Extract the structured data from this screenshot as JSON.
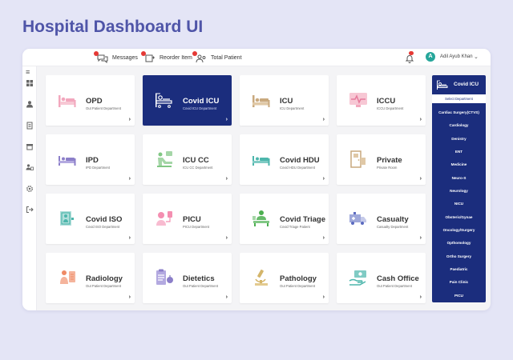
{
  "page": {
    "title": "Hospital Dashboard UI"
  },
  "topbar": {
    "items": [
      {
        "label": "Messages",
        "badge": "",
        "icon": "messages-icon"
      },
      {
        "label": "Reorder Item",
        "badge": "",
        "icon": "reorder-icon"
      },
      {
        "label": "Total Patient",
        "badge": "",
        "icon": "patients-icon"
      }
    ],
    "notification_icon": "bell-icon",
    "user": {
      "initial": "A",
      "name": "Adil Ayub Khan"
    }
  },
  "rail": [
    "menu-icon",
    "dashboard-icon",
    "user-icon",
    "document-icon",
    "archive-icon",
    "users-icon",
    "settings-icon",
    "logout-icon"
  ],
  "departments": [
    {
      "title": "OPD",
      "sub": "Out Patient Department",
      "icon": "opd-bed-icon",
      "active": false
    },
    {
      "title": "Covid ICU",
      "sub": "Covid ICU Department",
      "icon": "covid-icu-icon",
      "active": true
    },
    {
      "title": "ICU",
      "sub": "ICU Department",
      "icon": "icu-bed-icon",
      "active": false
    },
    {
      "title": "ICCU",
      "sub": "ICCU Department",
      "icon": "iccu-monitor-icon",
      "active": false
    },
    {
      "title": "IPD",
      "sub": "IPD Department",
      "icon": "ipd-bed-icon",
      "active": false
    },
    {
      "title": "ICU CC",
      "sub": "ICU CC Department",
      "icon": "icu-cc-icon",
      "active": false
    },
    {
      "title": "Covid HDU",
      "sub": "Covid HDU Department",
      "icon": "covid-hdu-icon",
      "active": false
    },
    {
      "title": "Private",
      "sub": "Private Room",
      "icon": "private-room-icon",
      "active": false
    },
    {
      "title": "Covid ISO",
      "sub": "Covid ISO Department",
      "icon": "covid-iso-icon",
      "active": false
    },
    {
      "title": "PICU",
      "sub": "PICU Department",
      "icon": "picu-icon",
      "active": false
    },
    {
      "title": "Covid Triage",
      "sub": "Covid Triage Patient",
      "icon": "covid-triage-icon",
      "active": false
    },
    {
      "title": "Casualty",
      "sub": "Casualty Department",
      "icon": "ambulance-icon",
      "active": false
    },
    {
      "title": "Radiology",
      "sub": "Out Patient Department",
      "icon": "radiology-icon",
      "active": false
    },
    {
      "title": "Dietetics",
      "sub": "Out Patient Department",
      "icon": "dietetics-icon",
      "active": false
    },
    {
      "title": "Pathology",
      "sub": "Out Patient Department",
      "icon": "microscope-icon",
      "active": false
    },
    {
      "title": "Cash Office",
      "sub": "Out Patient Department",
      "icon": "cash-icon",
      "active": false
    }
  ],
  "panel": {
    "title": "Covid ICU",
    "select_label": "Select Department",
    "items": [
      "Cardiac Surgery(CTVS)",
      "Cardiology",
      "Denistry",
      "ENT",
      "Medicine",
      "Neuro-S",
      "Neurology",
      "NICU",
      "Obsteric/Gynae",
      "Oncology/Surgery",
      "Opthomology",
      "Ortho Surgery",
      "Paediatric",
      "Pain Clinic",
      "PICU"
    ]
  },
  "colors": {
    "accent": "#1b2d7d",
    "title": "#4f55a8",
    "badge": "#e53935",
    "avatar": "#26a69a"
  }
}
